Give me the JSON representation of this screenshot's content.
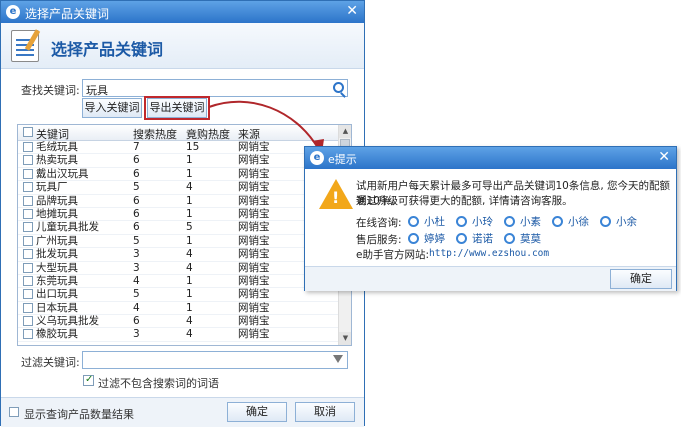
{
  "main_window": {
    "title": "选择产品关键词",
    "header_title": "选择产品关键词",
    "search_label": "查找关键词:",
    "search_value": "玩具",
    "import_label": "导入关键词",
    "export_label": "导出关键词",
    "columns": [
      "关键词",
      "搜索热度",
      "竟购热度",
      "来源"
    ],
    "rows": [
      {
        "kw": "毛绒玩具",
        "search": "7",
        "bid": "15",
        "src": "网销宝"
      },
      {
        "kw": "热卖玩具",
        "search": "6",
        "bid": "1",
        "src": "网销宝"
      },
      {
        "kw": "戴出汉玩具",
        "search": "6",
        "bid": "1",
        "src": "网销宝"
      },
      {
        "kw": "玩具厂",
        "search": "5",
        "bid": "4",
        "src": "网销宝"
      },
      {
        "kw": "品牌玩具",
        "search": "6",
        "bid": "1",
        "src": "网销宝"
      },
      {
        "kw": "地摊玩具",
        "search": "6",
        "bid": "1",
        "src": "网销宝"
      },
      {
        "kw": "儿童玩具批发",
        "search": "6",
        "bid": "5",
        "src": "网销宝"
      },
      {
        "kw": "广州玩具",
        "search": "5",
        "bid": "1",
        "src": "网销宝"
      },
      {
        "kw": "批发玩具",
        "search": "3",
        "bid": "4",
        "src": "网销宝"
      },
      {
        "kw": "大型玩具",
        "search": "3",
        "bid": "4",
        "src": "网销宝"
      },
      {
        "kw": "东莞玩具",
        "search": "4",
        "bid": "1",
        "src": "网销宝"
      },
      {
        "kw": "出口玩具",
        "search": "5",
        "bid": "1",
        "src": "网销宝"
      },
      {
        "kw": "日本玩具",
        "search": "4",
        "bid": "1",
        "src": "网销宝"
      },
      {
        "kw": "义乌玩具批发",
        "search": "6",
        "bid": "4",
        "src": "网销宝"
      },
      {
        "kw": "橡胶玩具",
        "search": "3",
        "bid": "4",
        "src": "网销宝"
      }
    ],
    "filter_label": "过滤关键词:",
    "filter_value": "",
    "filter_option_label": "过滤不包含搜索词的词语",
    "show_count_label": "显示查询产品数量结果",
    "ok_label": "确定",
    "cancel_label": "取消"
  },
  "popup": {
    "title": "e提示",
    "message_line1": "试用新用户每天累计最多可导出产品关键词10条信息, 您今天的配额剩10条。",
    "message_line2": "通过升级可获得更大的配额, 详情请咨询客服。",
    "online_label": "在线咨询:",
    "online_contacts": [
      "小杜",
      "小玲",
      "小素",
      "小徐",
      "小余"
    ],
    "aftersales_label": "售后服务:",
    "aftersales_contacts": [
      "婷婷",
      "诺诺",
      "莫莫"
    ],
    "site_label": "e助手官方网站:",
    "site_url": "http://www.ezshou.com",
    "ok_label": "确定"
  },
  "colors": {
    "accent": "#2c74c9",
    "highlight_red": "#c0282c",
    "warning": "#f2a71a"
  }
}
